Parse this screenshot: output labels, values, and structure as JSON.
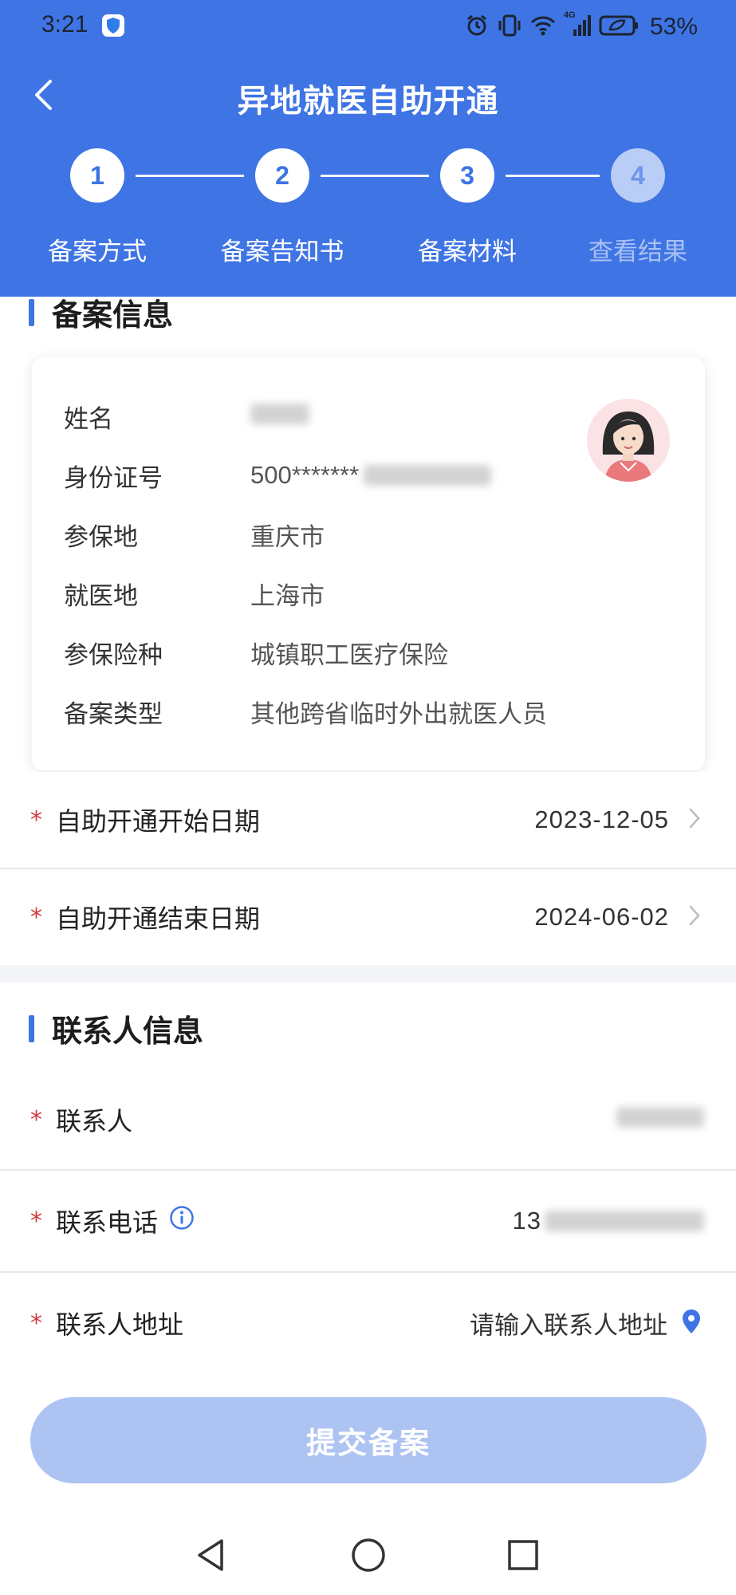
{
  "status_bar": {
    "time": "3:21",
    "network_label": "4G",
    "battery_percent": "53%"
  },
  "nav": {
    "title": "异地就医自助开通",
    "back_icon": "chevron-left-icon"
  },
  "stepper": {
    "steps": [
      {
        "number": "1",
        "label": "备案方式",
        "active": true
      },
      {
        "number": "2",
        "label": "备案告知书",
        "active": true
      },
      {
        "number": "3",
        "label": "备案材料",
        "active": true
      },
      {
        "number": "4",
        "label": "查看结果",
        "active": false
      }
    ]
  },
  "filing_info": {
    "section_title": "备案信息",
    "rows": [
      {
        "key": "姓名",
        "value": ""
      },
      {
        "key": "身份证号",
        "value": "500*******"
      },
      {
        "key": "参保地",
        "value": "重庆市"
      },
      {
        "key": "就医地",
        "value": "上海市"
      },
      {
        "key": "参保险种",
        "value": "城镇职工医疗保险"
      },
      {
        "key": "备案类型",
        "value": "其他跨省临时外出就医人员"
      }
    ]
  },
  "dates": {
    "required_mark": "*",
    "start_label": "自助开通开始日期",
    "start_value": "2023-12-05",
    "end_label": "自助开通结束日期",
    "end_value": "2024-06-02"
  },
  "contact": {
    "section_title": "联系人信息",
    "required_mark": "*",
    "contact_label": "联系人",
    "phone_label": "联系电话",
    "phone_value_prefix": "13",
    "address_label": "联系人地址",
    "address_placeholder": "请输入联系人地址"
  },
  "submit": {
    "label": "提交备案"
  },
  "colors": {
    "primary": "#3f74e4",
    "submit_disabled": "#adc4f3",
    "required": "#d23c3c"
  }
}
